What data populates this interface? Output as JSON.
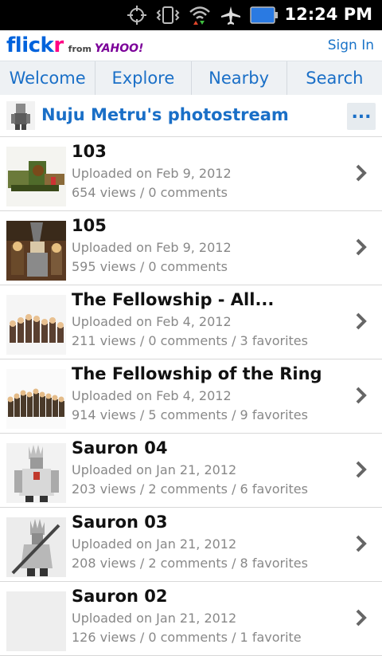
{
  "status_bar": {
    "time": "12:24 PM",
    "icons": [
      "gps-icon",
      "vibrate-icon",
      "wifi-icon",
      "airplane-icon",
      "battery-icon"
    ]
  },
  "header": {
    "logo_text_flickr_a": "flick",
    "logo_text_flickr_b": "r",
    "logo_from": "from",
    "logo_yahoo": "YAHOO!",
    "sign_in": "Sign In"
  },
  "nav": {
    "tabs": [
      {
        "label": "Welcome"
      },
      {
        "label": "Explore"
      },
      {
        "label": "Nearby"
      },
      {
        "label": "Search"
      }
    ]
  },
  "stream": {
    "title": "Nuju Metru's photostream",
    "more_label": "..."
  },
  "photos": [
    {
      "title": "103",
      "uploaded": "Uploaded on Feb 9, 2012",
      "stats": "654 views / 0 comments",
      "thumb": "lego-build"
    },
    {
      "title": "105",
      "uploaded": "Uploaded on Feb 9, 2012",
      "stats": "595 views / 0 comments",
      "thumb": "wizard"
    },
    {
      "title": "The Fellowship - All...",
      "uploaded": "Uploaded on Feb 4, 2012",
      "stats": "211 views / 0 comments / 3 favorites",
      "thumb": "group"
    },
    {
      "title": "The Fellowship of the Ring",
      "uploaded": "Uploaded on Feb 4, 2012",
      "stats": "914 views / 5 comments / 9 favorites",
      "thumb": "group"
    },
    {
      "title": "Sauron 04",
      "uploaded": "Uploaded on Jan 21, 2012",
      "stats": "203 views / 2 comments / 6 favorites",
      "thumb": "sauron"
    },
    {
      "title": "Sauron 03",
      "uploaded": "Uploaded on Jan 21, 2012",
      "stats": "208 views / 2 comments / 8 favorites",
      "thumb": "sauron"
    },
    {
      "title": "Sauron 02",
      "uploaded": "Uploaded on Jan 21, 2012",
      "stats": "126 views / 0 comments / 1 favorite",
      "thumb": "blank"
    }
  ],
  "colors": {
    "accent_blue": "#1a6fc7",
    "flickr_blue": "#0063dc",
    "flickr_pink": "#ff0084",
    "yahoo_purple": "#7b0099",
    "nav_bg": "#eef1f4"
  }
}
